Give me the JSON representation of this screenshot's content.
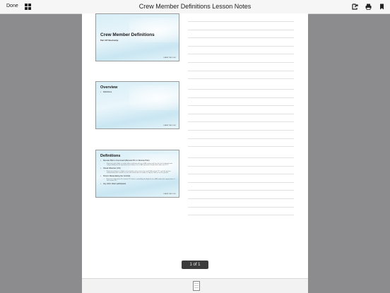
{
  "toolbar": {
    "done_label": "Done",
    "title": "Crew Member Definitions Lesson Notes"
  },
  "slides": [
    {
      "title": "Crew Member Definitions",
      "subtitle": "Part 107 Bootcamp",
      "footer": "LEARN THE LOGO"
    },
    {
      "title": "Overview",
      "bullets": [
        "Definitions"
      ],
      "footer": "LEARN THE LOGO"
    },
    {
      "title": "Definitions",
      "bullets": [
        "Remote Pilot in Command (Remote PIC or Remote Pilot)",
        "A person who holds a remote pilot certificate with an sUAS rating and has the final authority and responsibility for the operation and safety of an sUAS operation conducted under part 107",
        "Visual Observer (VO)",
        "A person acting as a flight crew member who assists the small UA remote PIC and the person manipulating the controls to see and avoid other air traffic or objects aloft or on the ground",
        "Person Manipulating the Controls",
        "A person other than the remote PIC who is controlling the flight of an sUAS under the supervision of the remote PIC",
        "Any other direct participants"
      ],
      "footer": "LEARN THE LOGO"
    }
  ],
  "pager": {
    "label": "1 of 1"
  },
  "colors": {
    "background": "#8c8c8e",
    "toolbar": "#f6f6f6",
    "accent": "#1a1a1a"
  },
  "icons": [
    "grid-icon",
    "share-icon",
    "print-icon",
    "bookmark-icon"
  ]
}
